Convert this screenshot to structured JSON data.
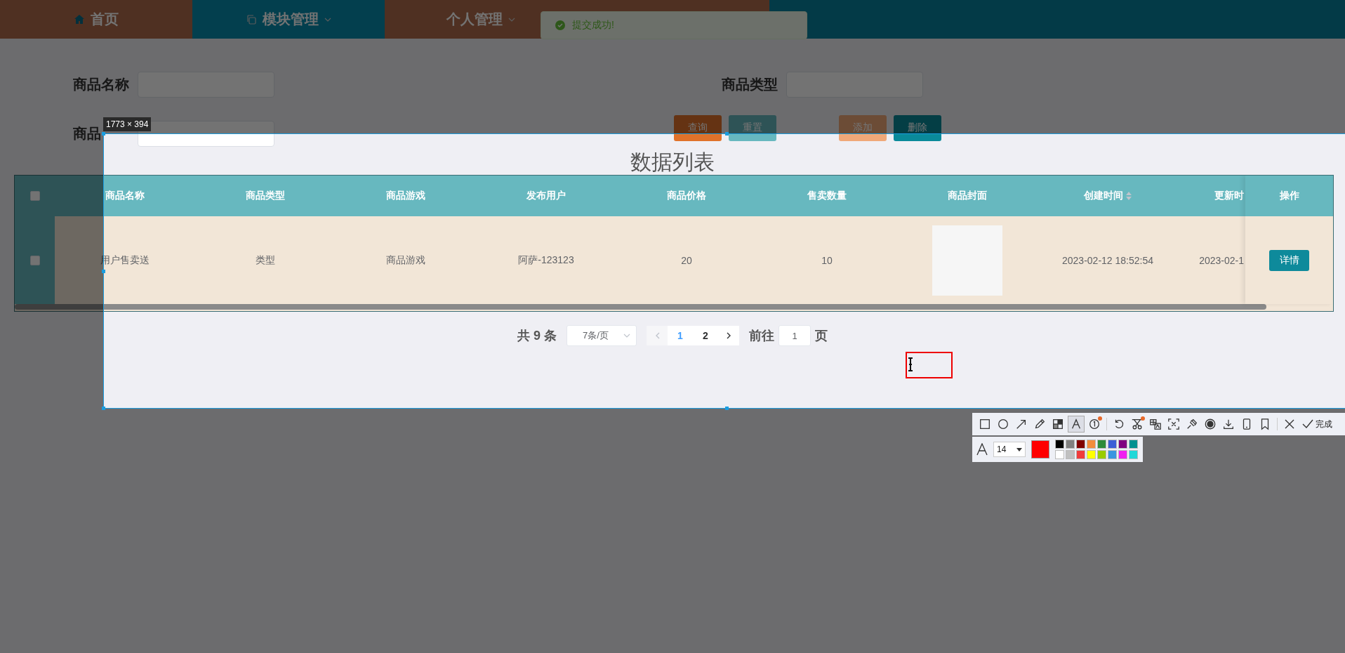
{
  "nav": {
    "items": [
      {
        "label": "首页",
        "selected": false,
        "has_menu": false
      },
      {
        "label": "模块管理",
        "selected": true,
        "has_menu": true
      },
      {
        "label": "个人管理",
        "selected": false,
        "has_menu": true
      }
    ]
  },
  "toast": {
    "message": "提交成功!"
  },
  "search_form": {
    "fields": [
      {
        "label": "商品名称"
      },
      {
        "label": "商品类型"
      },
      {
        "label": "商品"
      }
    ],
    "buttons": [
      {
        "label": "查询",
        "kind": "query"
      },
      {
        "label": "重置",
        "kind": "reset"
      },
      {
        "label": "添加",
        "kind": "add"
      },
      {
        "label": "删除",
        "kind": "delete"
      }
    ]
  },
  "title": "数据列表",
  "table": {
    "all_checked": false,
    "columns": [
      {
        "label": "商品名称",
        "sortable": false
      },
      {
        "label": "商品类型",
        "sortable": false
      },
      {
        "label": "商品游戏",
        "sortable": false
      },
      {
        "label": "发布用户",
        "sortable": false
      },
      {
        "label": "商品价格",
        "sortable": false
      },
      {
        "label": "售卖数量",
        "sortable": false
      },
      {
        "label": "商品封面",
        "sortable": false
      },
      {
        "label": "创建时间",
        "sortable": true
      },
      {
        "label": "更新时",
        "sortable": false
      }
    ],
    "action_column": "操作",
    "rows": [
      {
        "checked": false,
        "cells": [
          "用户售卖送",
          "类型",
          "商品游戏",
          "阿萨-123123",
          "20",
          "10",
          "",
          "2023-02-12 18:52:54",
          "2023-02-1"
        ],
        "action": "详情"
      }
    ]
  },
  "pagination": {
    "total": "共 9 条",
    "page_size": "7条/页",
    "pages": [
      {
        "label": "1",
        "selected": true
      },
      {
        "label": "2",
        "selected": false
      }
    ],
    "goto_label": "前往",
    "goto_value": "1",
    "goto_suffix": "页"
  },
  "screenshot_tool": {
    "size_label": "1773 × 394",
    "tools": [
      {
        "selected": false,
        "dot": false
      },
      {
        "selected": false,
        "dot": false
      },
      {
        "selected": false,
        "dot": false
      },
      {
        "selected": false,
        "dot": false
      },
      {
        "selected": false,
        "dot": false
      },
      {
        "selected": true,
        "dot": false
      },
      {
        "selected": false,
        "dot": true
      },
      {
        "selected": false,
        "dot": false
      },
      {
        "selected": false,
        "dot": true
      },
      {
        "selected": false,
        "dot": false
      },
      {
        "selected": false,
        "dot": false
      },
      {
        "selected": false,
        "dot": false
      },
      {
        "selected": false,
        "dot": false
      },
      {
        "selected": false,
        "dot": false
      },
      {
        "selected": false,
        "dot": false
      },
      {
        "selected": false,
        "dot": false
      }
    ],
    "done_label": "完成",
    "font_size": "14",
    "current": {
      "color": "#ff0000"
    },
    "palette": [
      {
        "color": "#000000"
      },
      {
        "color": "#808080"
      },
      {
        "color": "#800000"
      },
      {
        "color": "#f28c3c"
      },
      {
        "color": "#2e8b3a"
      },
      {
        "color": "#3c5fd6"
      },
      {
        "color": "#800080"
      },
      {
        "color": "#009090"
      },
      {
        "color": "#ffffff"
      },
      {
        "color": "#c0c0c0"
      },
      {
        "color": "#f03c3c"
      },
      {
        "color": "#ffff00"
      },
      {
        "color": "#99cc00"
      },
      {
        "color": "#3a96e0"
      },
      {
        "color": "#f020f0"
      },
      {
        "color": "#20d8d8"
      }
    ]
  }
}
